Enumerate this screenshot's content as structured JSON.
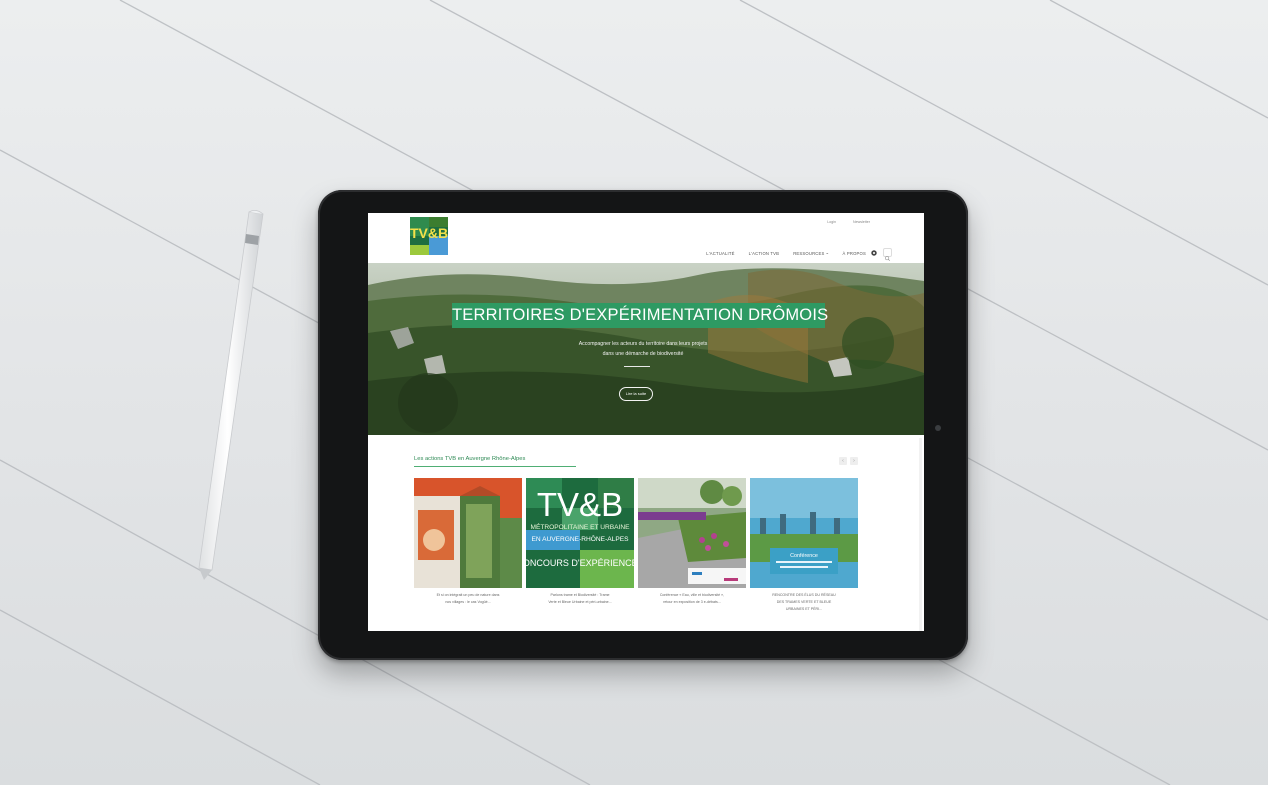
{
  "site": {
    "logo_text": "TV&B",
    "top_links": {
      "login": "Login",
      "newsletter": "Newsletter"
    },
    "nav": [
      "L'ACTUALITÉ",
      "L'ACTION TVB",
      "RESSOURCES ~",
      "À PROPOS"
    ],
    "icons": [
      "gear-icon",
      "search-icon"
    ]
  },
  "hero": {
    "title": "TERRITOIRES D'EXPÉRIMENTATION DRÔMOIS",
    "subtitle_line1": "Accompagner les acteurs du territoire dans leurs projets",
    "subtitle_line2": "dans une démarche de biodiversité",
    "button": "Lire la suite"
  },
  "actions": {
    "heading": "Les actions TVB en Auvergne Rhône-Alpes",
    "cards": [
      {
        "caption_line1": "Et si on intégrait un peu de nature dans",
        "caption_line2": "nos villages : le cas Vogüé..."
      },
      {
        "caption_line1": "Parlons trame et Biodiversité : Trame",
        "caption_line2": "Verte et Bleue Urbaine et péri-urbaine..."
      },
      {
        "caption_line1": "Conférence « Eau, ville et biodiversité »,",
        "caption_line2": "retour en exposition de 3 e-débats..."
      },
      {
        "caption_line1": "RENCONTRE DES ÉLUS DU RÉSEAU",
        "caption_line2": "DES TRAMES VERTE ET BLEUE",
        "caption_line3": "URBAINES ET PÉRI..."
      }
    ],
    "card2_big_text": "TV&B",
    "card2_lines": [
      "MÉTROPOLITAINE ET URBAINE",
      "EN AUVERGNE-RHÔNE-ALPES",
      "CONCOURS D'EXPÉRIENCES"
    ],
    "card4_title": "Conférence"
  },
  "colors": {
    "accent": "#2e9a63",
    "tablet_frame": "#141516"
  }
}
